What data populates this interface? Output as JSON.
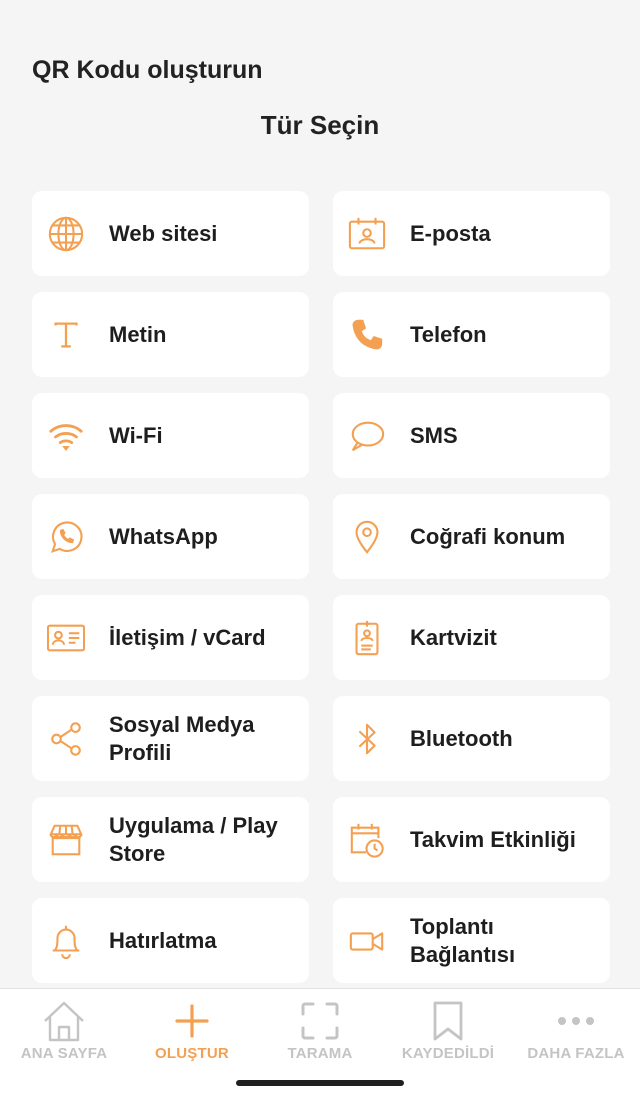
{
  "header": {
    "title": "QR Kodu oluşturun",
    "subtitle": "Tür Seçin"
  },
  "accent_color": "#f4a052",
  "types": [
    {
      "label": "Web sitesi",
      "icon": "globe-icon"
    },
    {
      "label": "E-posta",
      "icon": "email-card-icon"
    },
    {
      "label": "Metin",
      "icon": "text-icon"
    },
    {
      "label": "Telefon",
      "icon": "phone-icon"
    },
    {
      "label": "Wi-Fi",
      "icon": "wifi-icon"
    },
    {
      "label": "SMS",
      "icon": "sms-icon"
    },
    {
      "label": "WhatsApp",
      "icon": "whatsapp-icon"
    },
    {
      "label": "Coğrafi konum",
      "icon": "location-pin-icon"
    },
    {
      "label": "İletişim / vCard",
      "icon": "vcard-icon"
    },
    {
      "label": "Kartvizit",
      "icon": "badge-icon"
    },
    {
      "label": "Sosyal Medya\nProfili",
      "icon": "share-icon"
    },
    {
      "label": "Bluetooth",
      "icon": "bluetooth-icon"
    },
    {
      "label": "Uygulama / Play\nStore",
      "icon": "store-icon"
    },
    {
      "label": "Takvim Etkinliği",
      "icon": "calendar-clock-icon"
    },
    {
      "label": "Hatırlatma",
      "icon": "bell-icon"
    },
    {
      "label": "Toplantı\nBağlantısı",
      "icon": "video-camera-icon"
    }
  ],
  "bottom_nav": [
    {
      "label": "ANA SAYFA",
      "icon": "home-icon",
      "active": false
    },
    {
      "label": "OLUŞTUR",
      "icon": "plus-icon",
      "active": true
    },
    {
      "label": "TARAMA",
      "icon": "scan-frame-icon",
      "active": false
    },
    {
      "label": "KAYDEDİLDİ",
      "icon": "bookmark-icon",
      "active": false
    },
    {
      "label": "DAHA FAZLA",
      "icon": "more-dots-icon",
      "active": false
    }
  ]
}
